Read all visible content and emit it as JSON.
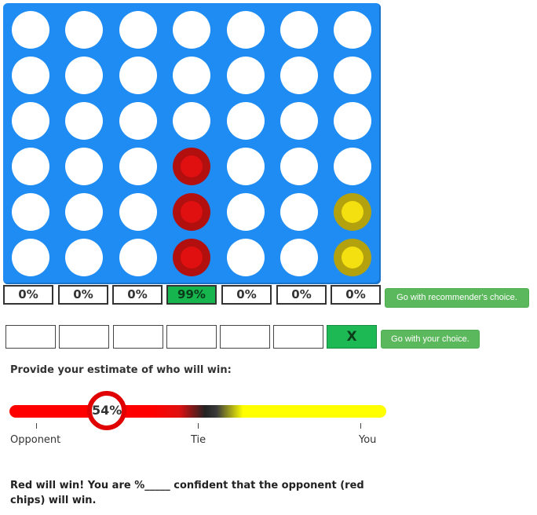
{
  "board": {
    "rows": 6,
    "cols": 7,
    "grid": [
      [
        "empty",
        "empty",
        "empty",
        "empty",
        "empty",
        "empty",
        "empty"
      ],
      [
        "empty",
        "empty",
        "empty",
        "empty",
        "empty",
        "empty",
        "empty"
      ],
      [
        "empty",
        "empty",
        "empty",
        "empty",
        "empty",
        "empty",
        "empty"
      ],
      [
        "empty",
        "empty",
        "empty",
        "red",
        "empty",
        "empty",
        "empty"
      ],
      [
        "empty",
        "empty",
        "empty",
        "red",
        "empty",
        "empty",
        "yellow"
      ],
      [
        "empty",
        "empty",
        "empty",
        "red",
        "empty",
        "empty",
        "yellow"
      ]
    ],
    "colors": {
      "board": "#1e8cf2",
      "red": "#e01010",
      "yellow": "#f4df10",
      "highlight": "#17b54e"
    }
  },
  "recommendations": {
    "percentages": [
      "0%",
      "0%",
      "0%",
      "99%",
      "0%",
      "0%",
      "0%"
    ],
    "best_column": 3,
    "button_label": "Go with recommender's choice."
  },
  "choices": {
    "marks": [
      "",
      "",
      "",
      "",
      "",
      "",
      "X"
    ],
    "selected_column": 6,
    "button_label": "Go with your choice."
  },
  "estimate": {
    "question": "Provide your estimate of who will win:",
    "value_label": "54%",
    "labels": {
      "left": "Opponent",
      "middle": "Tie",
      "right": "You"
    }
  },
  "result_text": "Red will win! You are %_____ confident that the opponent (red chips) will win."
}
